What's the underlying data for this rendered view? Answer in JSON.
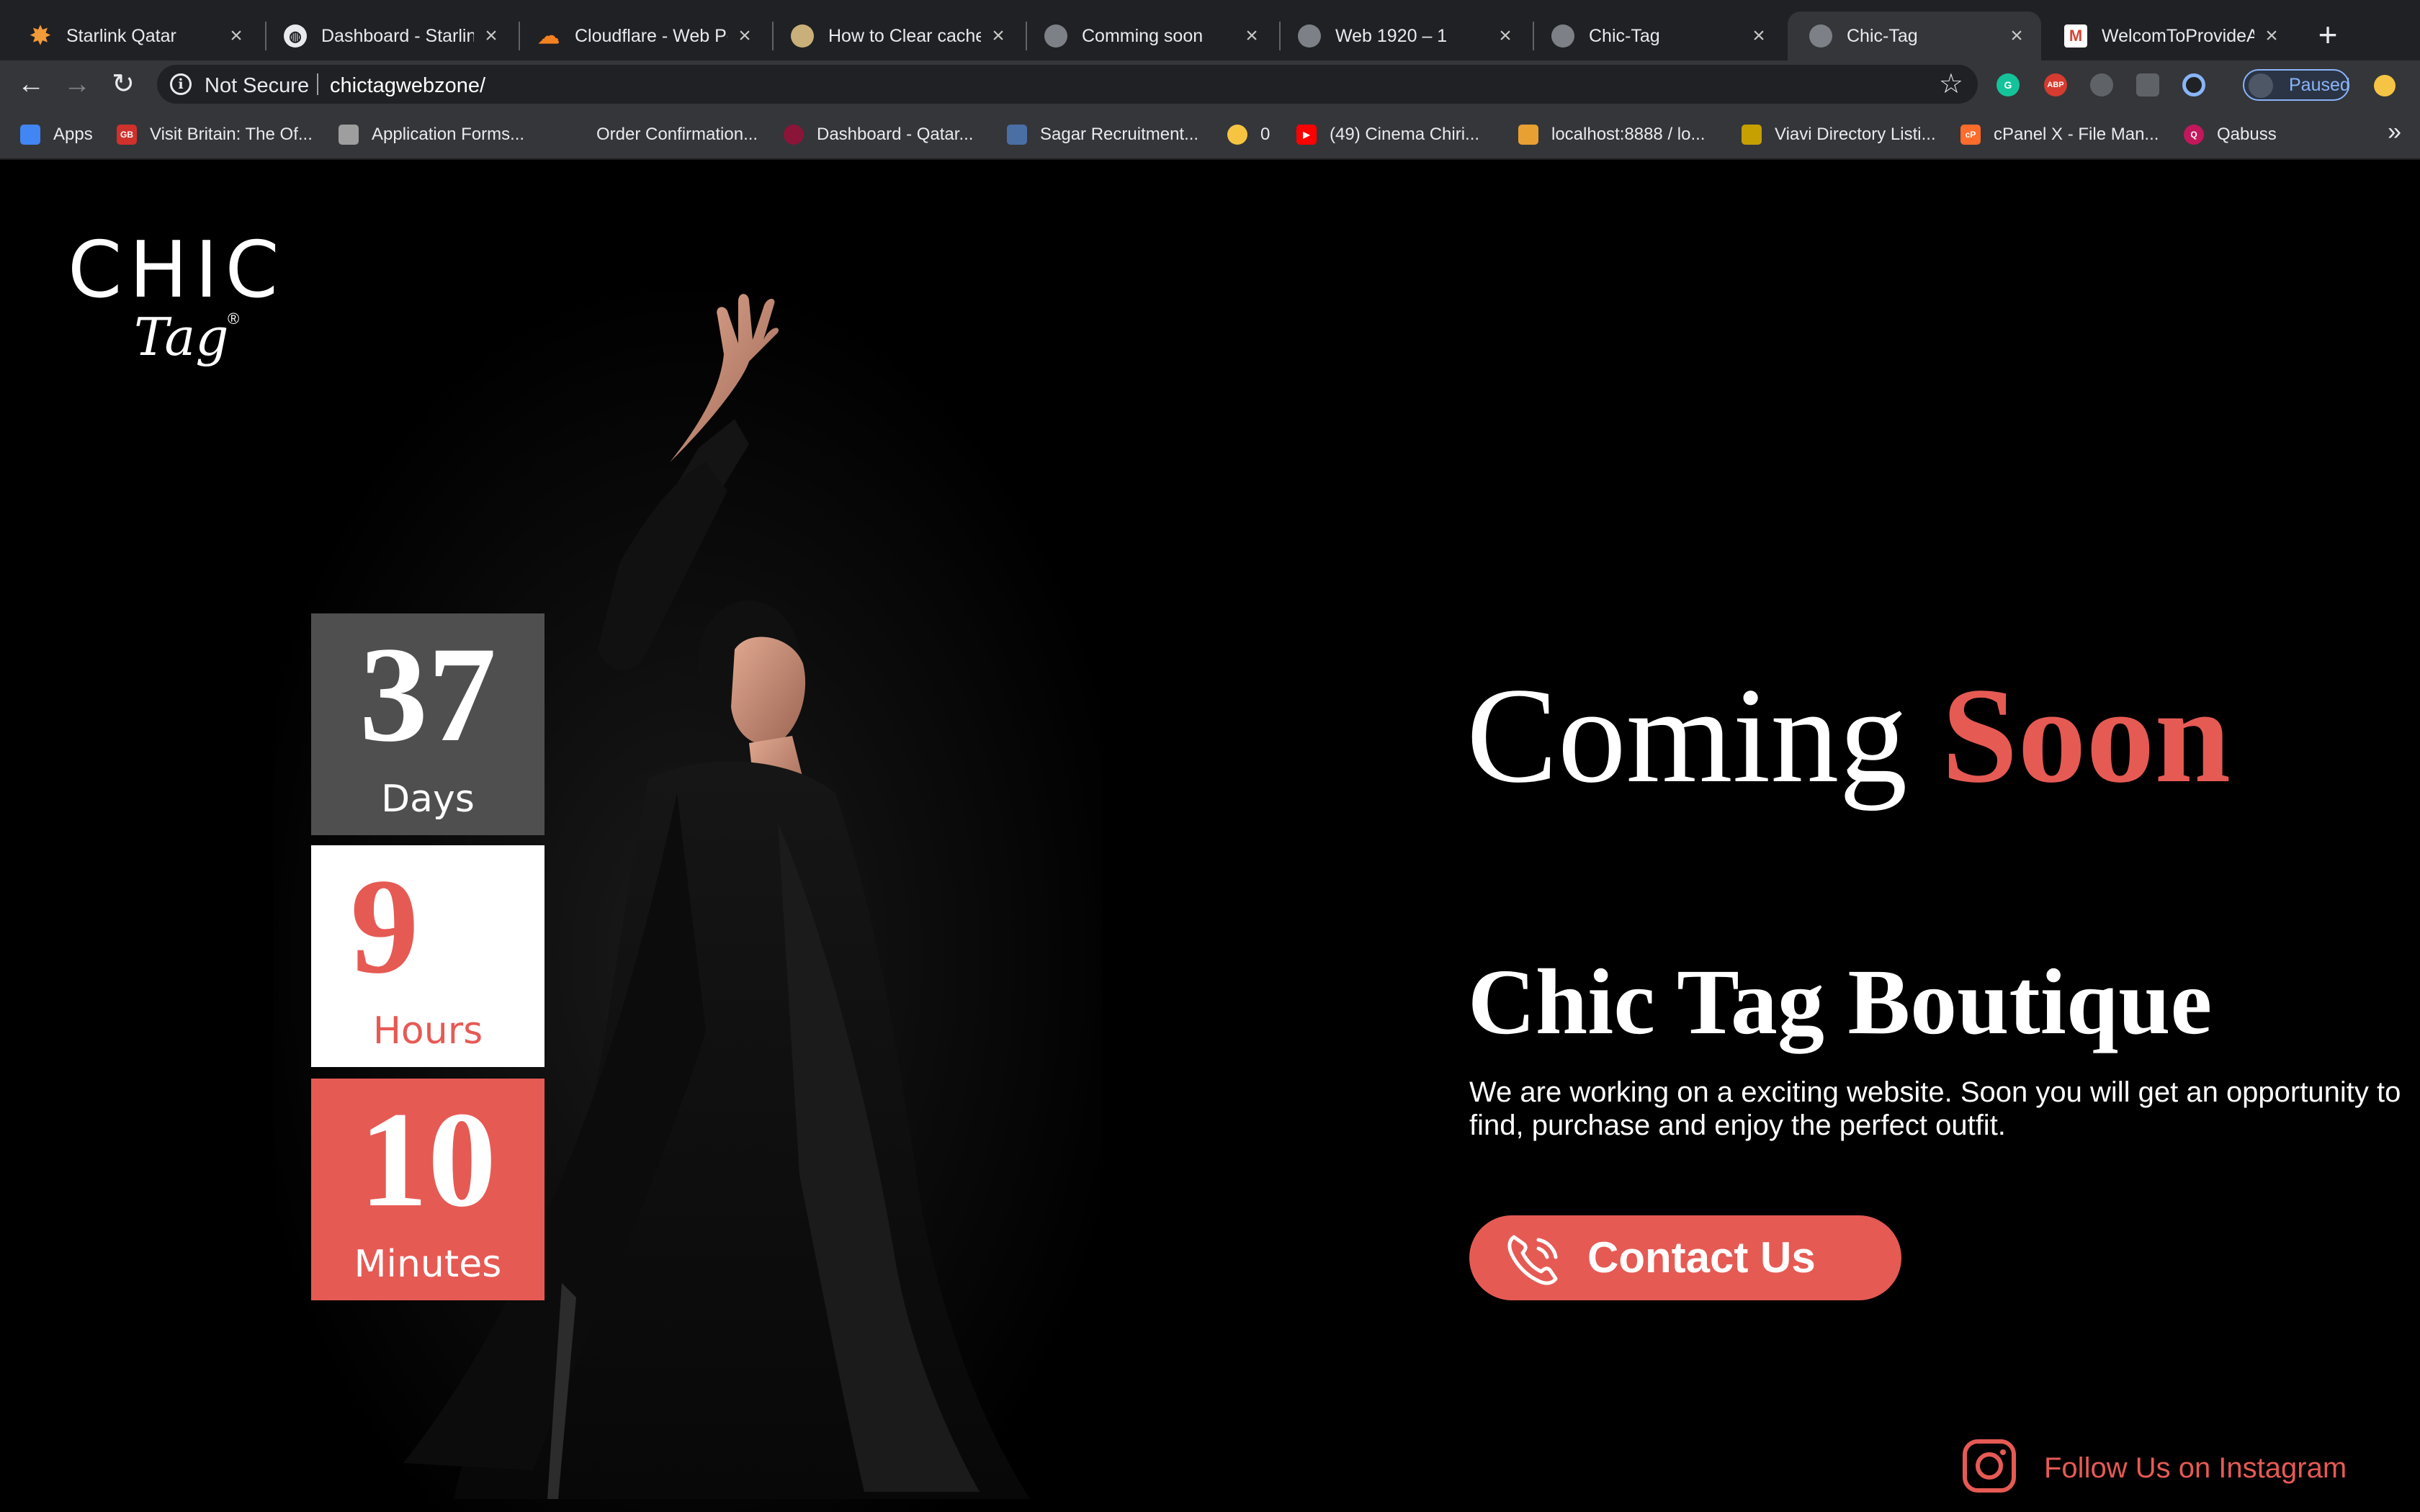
{
  "browser": {
    "tabs": [
      {
        "title": "Starlink Qatar",
        "icon": "star-icon",
        "color": "#f29b38",
        "active": false
      },
      {
        "title": "Dashboard - Starlink",
        "icon": "globe-icon",
        "color": "#e8eaed",
        "active": false
      },
      {
        "title": "Cloudflare - Web Per",
        "icon": "cloud-icon",
        "color": "#f48120",
        "active": false
      },
      {
        "title": "How to Clear cache i",
        "icon": "site-icon",
        "color": "#c9b07a",
        "active": false
      },
      {
        "title": "Comming soon",
        "icon": "globe-icon",
        "color": "#7d8187",
        "active": false
      },
      {
        "title": "Web 1920 – 1",
        "icon": "globe-icon",
        "color": "#7d8187",
        "active": false
      },
      {
        "title": "Chic-Tag",
        "icon": "globe-icon",
        "color": "#7d8187",
        "active": false
      },
      {
        "title": "Chic-Tag",
        "icon": "globe-icon",
        "color": "#7d8187",
        "active": true
      },
      {
        "title": "WelcomToProvideAu",
        "icon": "gmail-icon",
        "color": "#d44638",
        "active": false
      }
    ],
    "close_glyph": "×",
    "new_tab_glyph": "+",
    "nav": {
      "back": "←",
      "forward": "→",
      "reload": "↻"
    },
    "security_label": "Not Secure",
    "info_glyph": "i",
    "url": "chictagwebzone/",
    "star_glyph": "☆",
    "extensions": [
      {
        "icon": "grammarly-icon",
        "color": "#15c39a",
        "text": "G"
      },
      {
        "icon": "adblock-icon",
        "color": "#d63b2f",
        "text": "ABP"
      },
      {
        "icon": "extension-cloud-icon",
        "color": "#5f6368",
        "text": ""
      },
      {
        "icon": "camera-icon",
        "color": "#5f6368",
        "text": ""
      },
      {
        "icon": "circle-extension-icon",
        "color": "#8ab4f8",
        "text": ""
      }
    ],
    "profile_label": "Paused",
    "bookmarks": [
      {
        "label": "Apps",
        "icon": "apps-grid-icon",
        "color": "#4285f4",
        "text": ""
      },
      {
        "label": "Visit Britain: The Of...",
        "icon": "gb-flag-icon",
        "color": "#d0312d",
        "text": "GB"
      },
      {
        "label": "Application Forms...",
        "icon": "form-icon",
        "color": "#9e9e9e",
        "text": ""
      },
      {
        "label": "Order Confirmation...",
        "icon": "document-icon",
        "color": "#35363a",
        "text": ""
      },
      {
        "label": "Dashboard - Qatar...",
        "icon": "qatar-icon",
        "color": "#8a1538",
        "text": ""
      },
      {
        "label": "Sagar Recruitment...",
        "icon": "recruit-icon",
        "color": "#4a6fa5",
        "text": ""
      },
      {
        "label": "0",
        "icon": "emoji-icon",
        "color": "#f5c542",
        "text": ""
      },
      {
        "label": "(49) Cinema Chiri...",
        "icon": "youtube-icon",
        "color": "#ff0000",
        "text": "▶"
      },
      {
        "label": "localhost:8888 / lo...",
        "icon": "phpmyadmin-icon",
        "color": "#e8a033",
        "text": ""
      },
      {
        "label": "Viavi Directory Listi...",
        "icon": "directory-icon",
        "color": "#c5a000",
        "text": ""
      },
      {
        "label": "cPanel X - File Man...",
        "icon": "cpanel-icon",
        "color": "#ff6c2c",
        "text": "cP"
      },
      {
        "label": "Qabuss",
        "icon": "qabuss-icon",
        "color": "#c2185b",
        "text": "Q"
      }
    ],
    "more_glyph": "»"
  },
  "page": {
    "logo_word": "CHIC",
    "logo_script": "Tag",
    "logo_reg": "®",
    "countdown": [
      {
        "value": "37",
        "label": "Days"
      },
      {
        "value": "9",
        "label": "Hours"
      },
      {
        "value": "10",
        "label": "Minutes"
      }
    ],
    "headline_part1": "Coming",
    "headline_part2": "Soon",
    "brand_title": "Chic Tag Boutique",
    "description": "We are working on a exciting website. Soon you will get an opportunity to find, purchase and enjoy the perfect outfit.",
    "contact_label": "Contact Us",
    "instagram_label": "Follow Us on Instagram",
    "accent_color": "#e65a54",
    "days_box_color": "#4f4f4f"
  }
}
